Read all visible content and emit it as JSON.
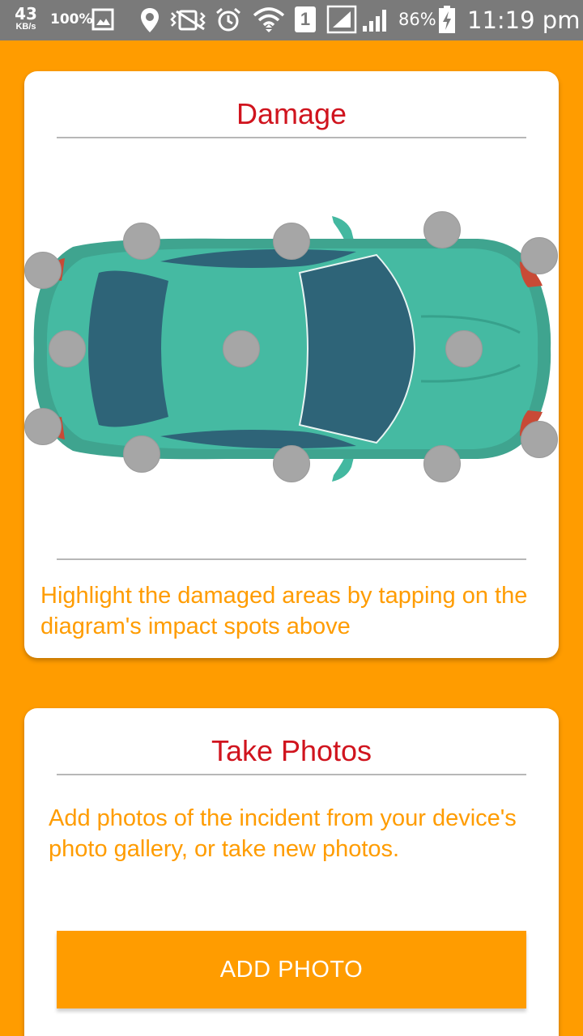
{
  "status_bar": {
    "net_speed": "43",
    "net_speed_unit": "KB/s",
    "data_saver_percent": "100%",
    "sim_slot": "1",
    "battery_percent": "86%",
    "time": "11:19 pm",
    "icons": [
      "image-icon",
      "location-icon",
      "vibrate-icon",
      "alarm-icon",
      "wifi-icon",
      "sim-icon",
      "signal-icon",
      "battery-charging-icon"
    ]
  },
  "damage_card": {
    "title": "Damage",
    "hint": "Highlight the damaged areas by tapping on the diagram's impact spots above",
    "impact_spots": [
      "front-left-corner",
      "front-left-side",
      "front-center",
      "front-right-side",
      "front-right-corner",
      "left-door-front",
      "left-door-rear",
      "roof",
      "right-door-front",
      "right-door-rear",
      "hood",
      "rear-left-corner",
      "rear-left-side",
      "rear-center",
      "rear-right-side",
      "rear-right-corner"
    ]
  },
  "photos_card": {
    "title": "Take Photos",
    "hint": "Add photos of the incident from your device's photo gallery, or take new photos.",
    "button_label": "ADD PHOTO"
  },
  "colors": {
    "background": "#FF9C00",
    "title_red": "#D0141E",
    "hint_orange": "#FF9C00",
    "car_body": "#43B8A0",
    "car_glass": "#2E6478",
    "spot_grey": "#A6A6A6"
  }
}
